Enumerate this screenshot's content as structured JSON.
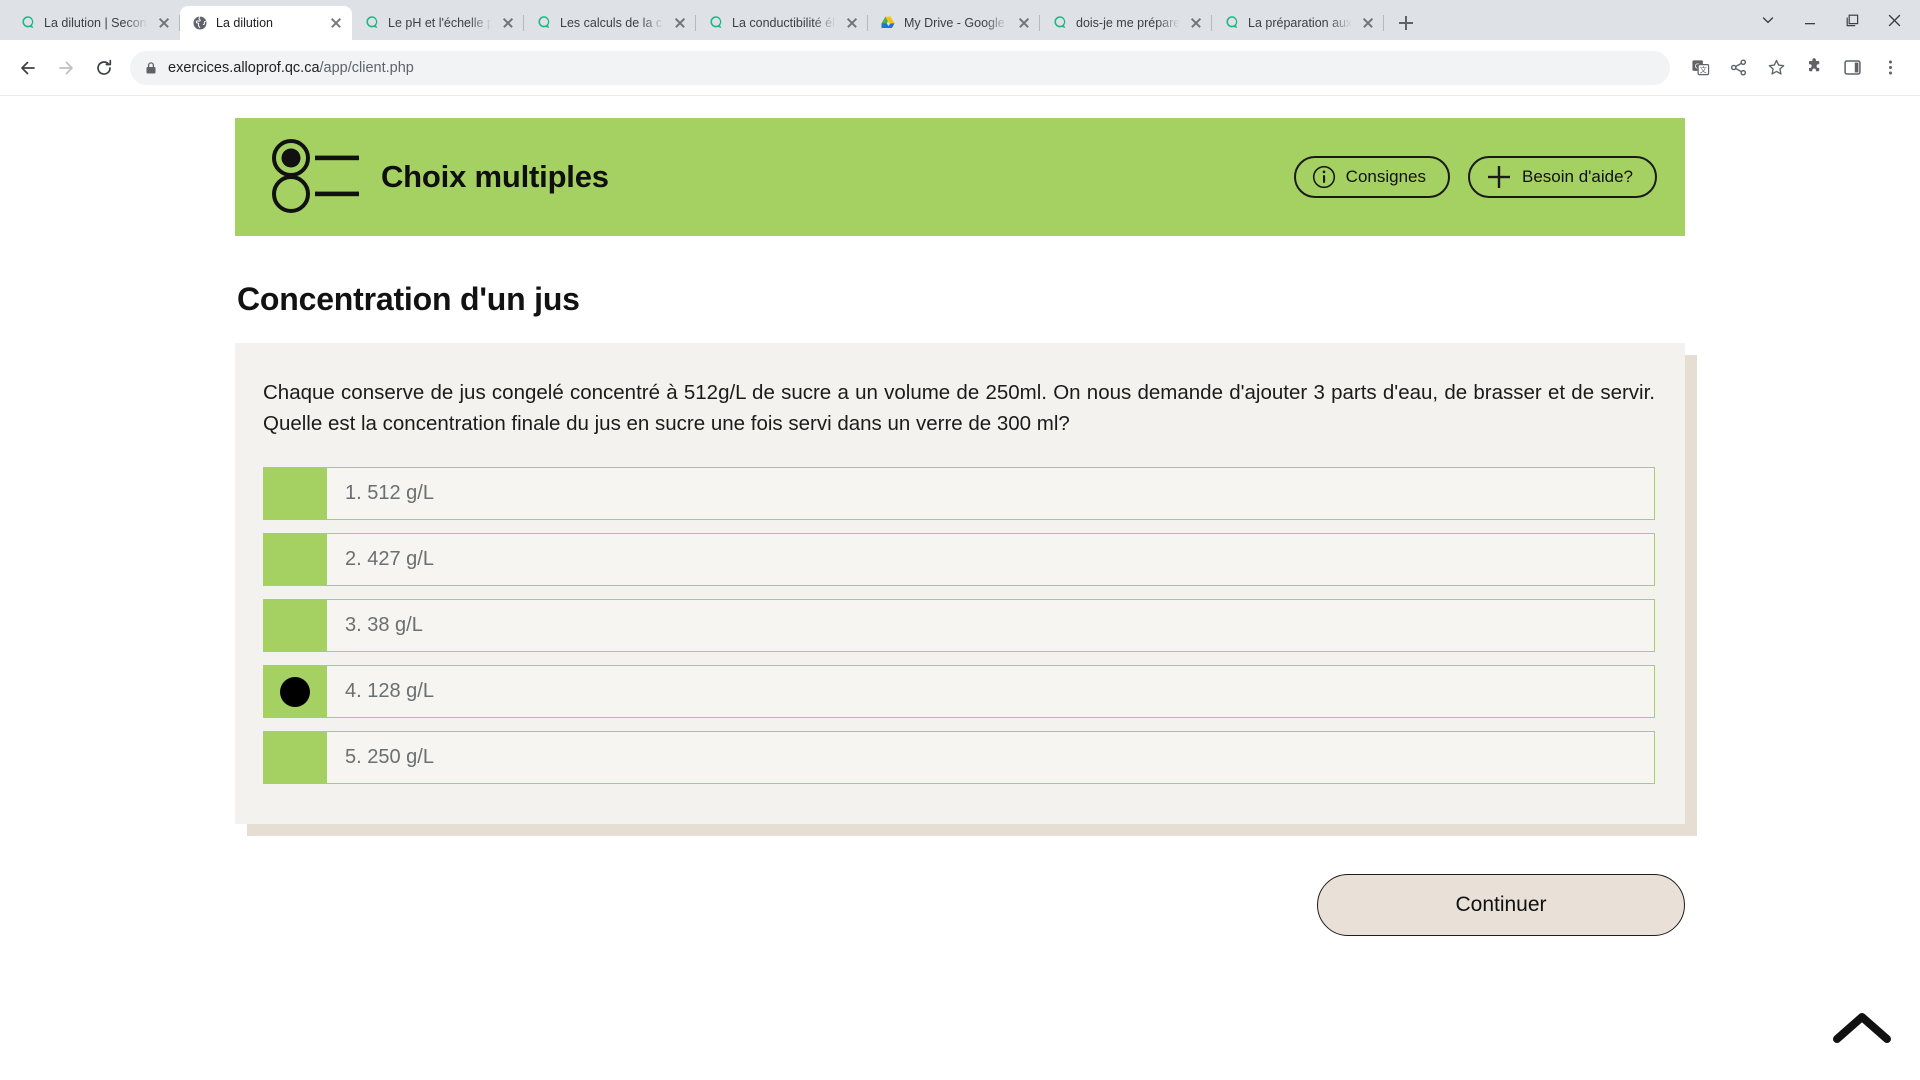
{
  "browser": {
    "tabs": [
      {
        "title": "La dilution | Secon",
        "favicon": "alloprof-icon",
        "active": false
      },
      {
        "title": "La dilution",
        "favicon": "globe-icon",
        "active": true
      },
      {
        "title": "Le pH et l'échelle p",
        "favicon": "alloprof-icon",
        "active": false
      },
      {
        "title": "Les calculs de la c",
        "favicon": "alloprof-icon",
        "active": false
      },
      {
        "title": "La conductibilité él",
        "favicon": "alloprof-icon",
        "active": false
      },
      {
        "title": "My Drive - Google D",
        "favicon": "google-drive-icon",
        "active": false
      },
      {
        "title": "dois-je me prépare",
        "favicon": "alloprof-icon",
        "active": false
      },
      {
        "title": "La préparation aux",
        "favicon": "alloprof-icon",
        "active": false
      }
    ],
    "new_tab_label": "+",
    "window_controls": [
      "tab-search-chevron",
      "minimize",
      "maximize",
      "close"
    ],
    "nav": {
      "back": "back-arrow",
      "forward": "forward-arrow",
      "reload": "reload-arrow"
    },
    "omnibox": {
      "lock": "lock-icon",
      "url_main": "exercices.alloprof.qc.ca",
      "url_path": "/app/client.php"
    },
    "toolbar_right": [
      "translate-icon",
      "share-icon",
      "bookmark-star-icon",
      "extensions-puzzle-icon",
      "side-panel-icon",
      "chrome-menu-icon"
    ]
  },
  "exercise": {
    "header": {
      "icon": "multiple-choice-icon",
      "title": "Choix multiples",
      "instructions_label": "Consignes",
      "help_label": "Besoin d'aide?"
    },
    "question_title": "Concentration d'un jus",
    "question_text": "Chaque conserve de jus congelé concentré à 512g/L de sucre a un volume de 250ml. On nous demande d'ajouter 3 parts d'eau, de brasser et de servir. Quelle est la concentration finale du jus en sucre une fois servi dans un verre de 300 ml?",
    "options": [
      {
        "label": "1. 512 g/L",
        "selected": false
      },
      {
        "label": "2. 427 g/L",
        "selected": false
      },
      {
        "label": "3. 38 g/L",
        "selected": false
      },
      {
        "label": "4. 128 g/L",
        "selected": true
      },
      {
        "label": "5. 250 g/L",
        "selected": false
      }
    ],
    "continue_label": "Continuer",
    "scroll_top_icon": "chevron-up-icon"
  },
  "colors": {
    "brand_green": "#a5d163",
    "card_bg": "#f3f2ee",
    "card_shadow": "#e6ded3",
    "button_beige": "#e9e1d7",
    "option_text": "#6a6f72"
  }
}
